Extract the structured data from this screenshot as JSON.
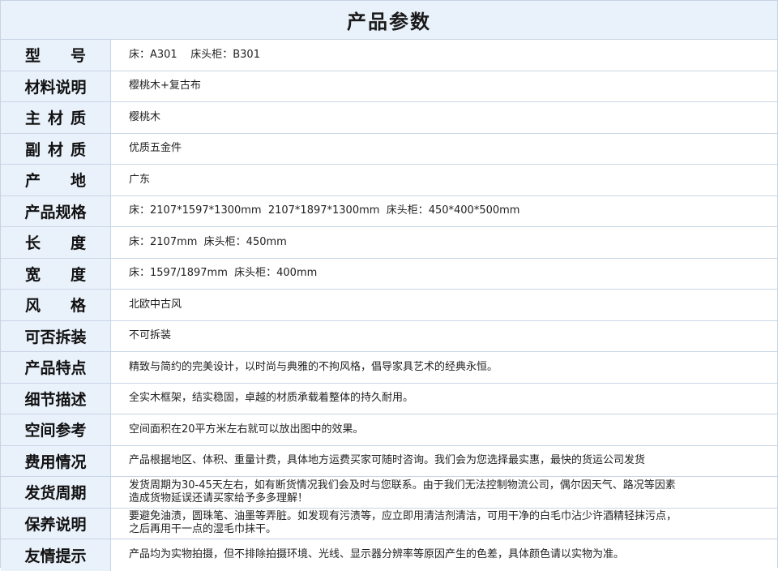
{
  "title": "产品参数",
  "rows": [
    {
      "chars": [
        "型",
        "号"
      ],
      "value": "床：A301    床头柜：B301"
    },
    {
      "label": "材料说明",
      "value": "樱桃木+复古布"
    },
    {
      "chars": [
        "主",
        "材",
        "质"
      ],
      "value": "樱桃木"
    },
    {
      "chars": [
        "副",
        "材",
        "质"
      ],
      "value": "优质五金件"
    },
    {
      "chars": [
        "产",
        "地"
      ],
      "value": "广东"
    },
    {
      "label": "产品规格",
      "value": "床：2107*1597*1300mm  2107*1897*1300mm  床头柜：450*400*500mm"
    },
    {
      "chars": [
        "长",
        "度"
      ],
      "value": "床：2107mm  床头柜：450mm"
    },
    {
      "chars": [
        "宽",
        "度"
      ],
      "value": "床：1597/1897mm  床头柜：400mm"
    },
    {
      "chars": [
        "风",
        "格"
      ],
      "value": "北欧中古风"
    },
    {
      "label": "可否拆装",
      "value": "不可拆装"
    },
    {
      "label": "产品特点",
      "value": "精致与简约的完美设计，以时尚与典雅的不拘风格，倡导家具艺术的经典永恒。"
    },
    {
      "label": "细节描述",
      "value": "全实木框架，结实稳固，卓越的材质承载着整体的持久耐用。"
    },
    {
      "label": "空间参考",
      "value": "空间面积在20平方米左右就可以放出图中的效果。"
    },
    {
      "label": "费用情况",
      "value": "产品根据地区、体积、重量计费，具体地方运费买家可随时咨询。我们会为您选择最实惠，最快的货运公司发货"
    },
    {
      "label": "发货周期",
      "value": "发货周期为30-45天左右，如有断货情况我们会及时与您联系。由于我们无法控制物流公司，偶尔因天气、路况等因素\n造成货物延误还请买家给予多多理解！"
    },
    {
      "label": "保养说明",
      "value": "要避免油渍，圆珠笔、油墨等弄脏。如发现有污渍等，应立即用清洁剂清洁，可用干净的白毛巾沾少许酒精轻抹污点，\n之后再用干一点的湿毛巾抹干。"
    },
    {
      "label": "友情提示",
      "value": "产品均为实物拍摄，但不排除拍摄环境、光线、显示器分辨率等原因产生的色差，具体颜色请以实物为准。"
    }
  ]
}
